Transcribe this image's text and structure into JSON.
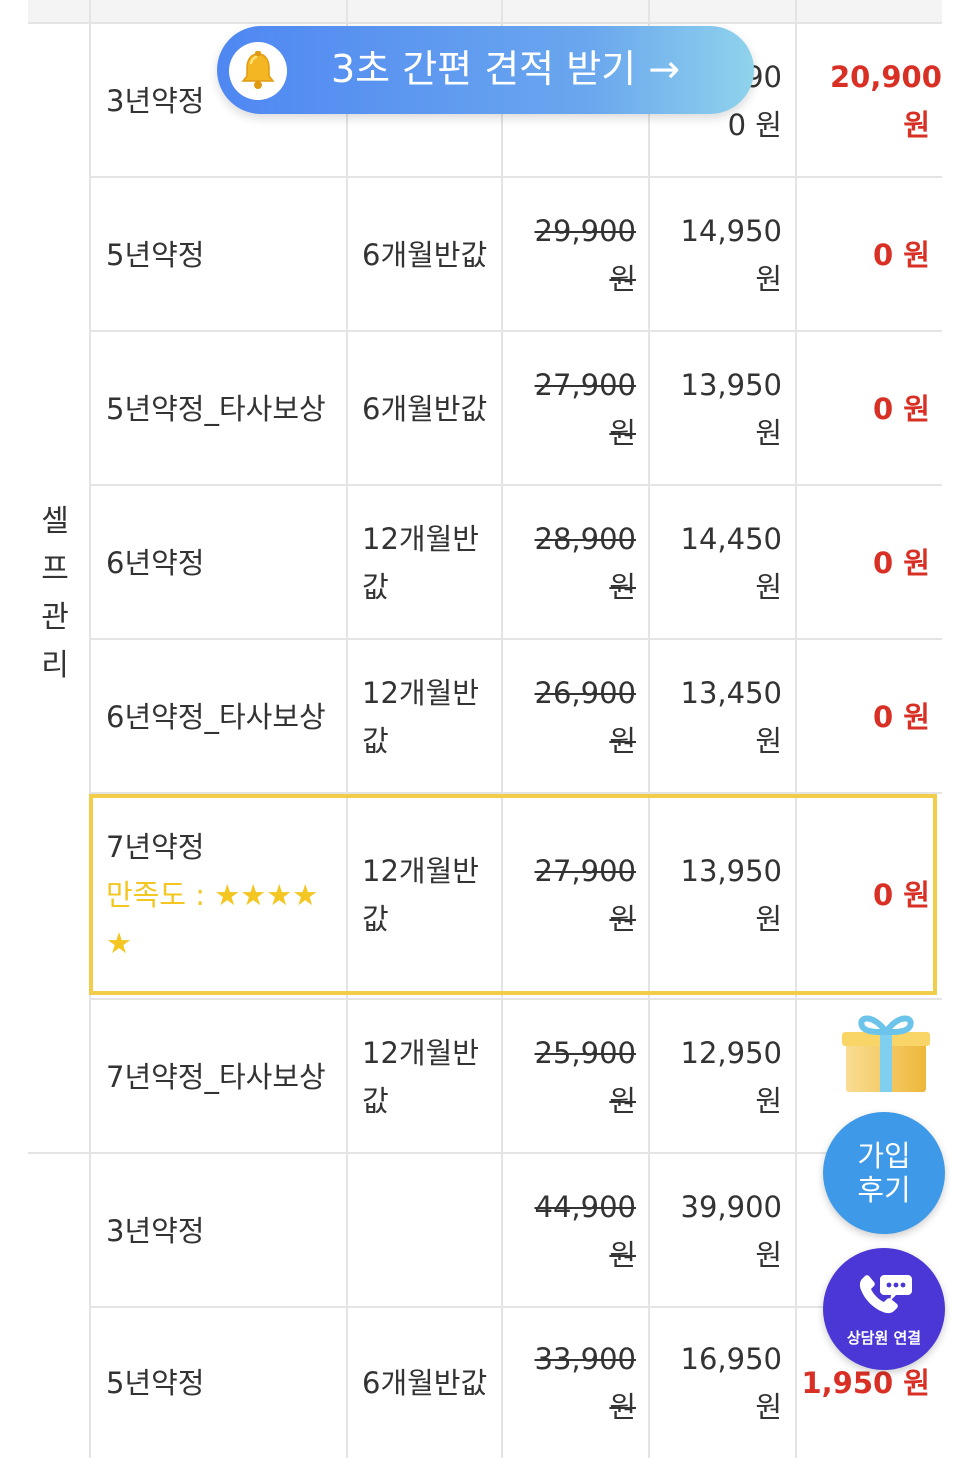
{
  "banner": {
    "label": "3초 간편 견적 받기 →",
    "icon": "bell-icon"
  },
  "group": {
    "label": "셀프관리"
  },
  "rows_group1": [
    {
      "plan": "3년약정",
      "benefit": "",
      "original": "",
      "discount": "0 원",
      "final": "20,900 원",
      "discount_partial": "90"
    },
    {
      "plan": "5년약정",
      "benefit": "6개월반값",
      "original": "29,900 원",
      "discount": "14,950 원",
      "final": "0 원"
    },
    {
      "plan": "5년약정_타사보상",
      "benefit": "6개월반값",
      "original": "27,900 원",
      "discount": "13,950 원",
      "final": "0 원"
    },
    {
      "plan": "6년약정",
      "benefit": "12개월반값",
      "original": "28,900 원",
      "discount": "14,450 원",
      "final": "0 원"
    },
    {
      "plan": "6년약정_타사보상",
      "benefit": "12개월반값",
      "original": "26,900 원",
      "discount": "13,450 원",
      "final": "0 원"
    },
    {
      "plan": "7년약정",
      "rating": "만족도 : ★★★★★",
      "benefit": "12개월반값",
      "original": "27,900 원",
      "discount": "13,950 원",
      "final": "0 원"
    },
    {
      "plan": "7년약정_타사보상",
      "benefit": "12개월반값",
      "original": "25,900 원",
      "discount": "12,950 원",
      "final": ""
    }
  ],
  "rows_group2": [
    {
      "plan": "3년약정",
      "benefit": "",
      "original": "44,900 원",
      "discount": "39,900 원",
      "final": ""
    },
    {
      "plan": "5년약정",
      "benefit": "6개월반값",
      "original": "33,900 원",
      "discount": "16,950 원",
      "final": "1,950 원"
    }
  ],
  "floating": {
    "gift_icon": "gift-icon",
    "review_label_1": "가입",
    "review_label_2": "후기",
    "consult_label": "상담원 연결",
    "consult_icon": "phone-chat-icon"
  },
  "colors": {
    "price_red": "#d93025",
    "highlight_border": "#f2cd4a",
    "rating_yellow": "#f3c622",
    "review_blue": "#3e9ae8",
    "consult_purple": "#4a37d6"
  }
}
